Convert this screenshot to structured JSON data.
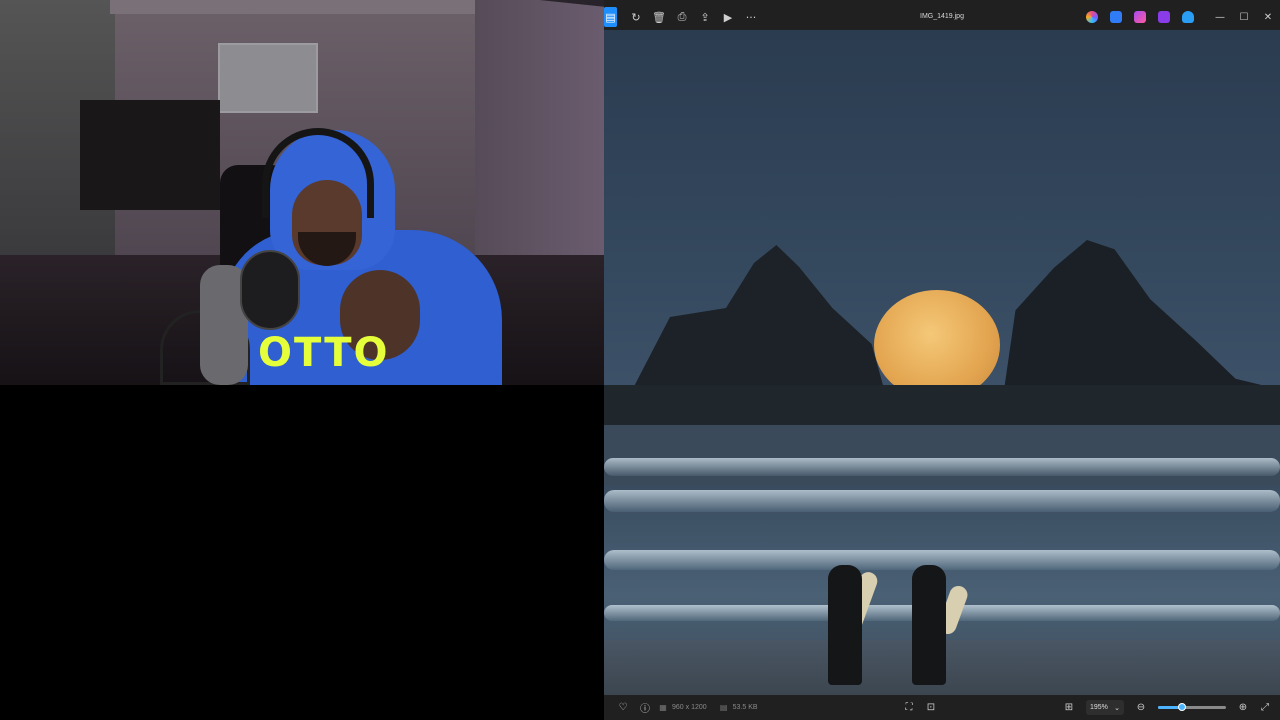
{
  "viewer": {
    "title": "IMG_1419.jpg",
    "toolbar": [
      {
        "name": "gallery",
        "glyph": "▤"
      },
      {
        "name": "rotate",
        "glyph": "↻"
      },
      {
        "name": "delete",
        "glyph": "🗑"
      },
      {
        "name": "print",
        "glyph": "⎙"
      },
      {
        "name": "share",
        "glyph": "⇪"
      },
      {
        "name": "slideshow",
        "glyph": "▶"
      },
      {
        "name": "more",
        "glyph": "···"
      }
    ],
    "window_controls": {
      "minimize": "—",
      "maximize": "☐",
      "close": "✕"
    },
    "status": {
      "dimensions": "960 x 1200",
      "filesize": "53.5 KB",
      "zoom": "195%",
      "zoom_chevron": "⌄",
      "zoom_level_fraction": 0.35
    },
    "icons": {
      "favorite": "♡",
      "info": "ⓘ",
      "dims_icon": "▦",
      "size_icon": "▤",
      "fit": "⛶",
      "actual": "⊡",
      "actual2": "⊞",
      "zoom_out": "⊖",
      "zoom_in": "⊕",
      "fullscreen": "⤢"
    }
  },
  "webcam": {
    "hoodie_text": "OTTO"
  },
  "colors": {
    "accent": "#1f8fff",
    "slider": "#4cb4ff"
  }
}
